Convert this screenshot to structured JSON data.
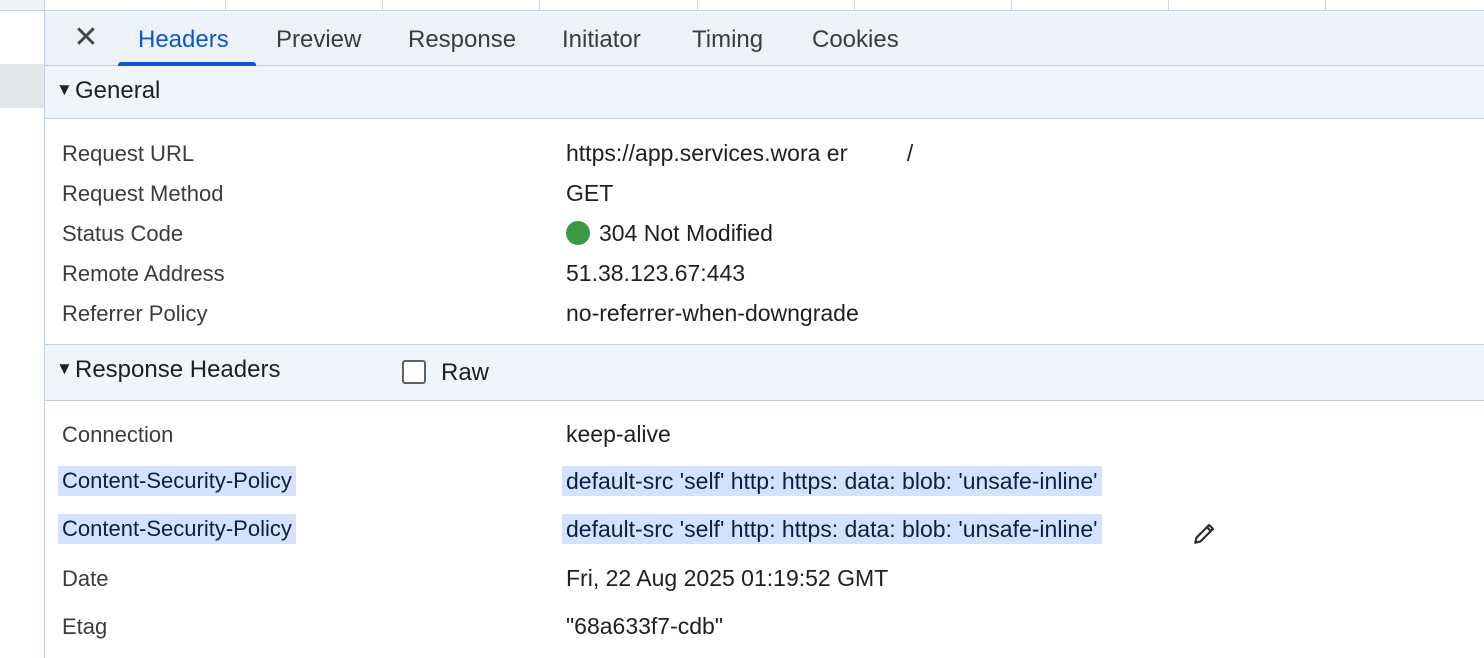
{
  "tabs": [
    {
      "label": "Headers",
      "active": true
    },
    {
      "label": "Preview",
      "active": false
    },
    {
      "label": "Response",
      "active": false
    },
    {
      "label": "Initiator",
      "active": false
    },
    {
      "label": "Timing",
      "active": false
    },
    {
      "label": "Cookies",
      "active": false
    }
  ],
  "close_icon": "✕",
  "general": {
    "title": "General",
    "rows": [
      {
        "key": "Request URL",
        "value": "https://app.services.wora ery.com/"
      },
      {
        "key": "Request Method",
        "value": "GET"
      },
      {
        "key": "Status Code",
        "value": "304 Not Modified"
      },
      {
        "key": "Remote Address",
        "value": "51.38.123.67:443"
      },
      {
        "key": "Referrer Policy",
        "value": "no-referrer-when-downgrade"
      }
    ]
  },
  "response_headers": {
    "title": "Response Headers",
    "raw_label": "Raw",
    "raw_checked": false,
    "rows": [
      {
        "key": "Connection",
        "value": "keep-alive"
      },
      {
        "key": "Content-Security-Policy",
        "value": "default-src 'self' http: https: data: blob: 'unsafe-inline'"
      },
      {
        "key": "Content-Security-Policy",
        "value": "default-src 'self' http: https: data: blob: 'unsafe-inline'"
      },
      {
        "key": "Date",
        "value": "Fri, 22 Aug 2025 01:19:52 GMT"
      },
      {
        "key": "Etag",
        "value": "\"68a633f7-cdb\""
      }
    ]
  },
  "colors": {
    "accent": "#0b57d0",
    "status_ok": "#3c9a45",
    "selection": "#d3e3fd"
  },
  "icons": {
    "close": "close-icon",
    "collapse": "triangle-down-icon",
    "status": "status-dot-icon",
    "edit": "pencil-icon"
  }
}
